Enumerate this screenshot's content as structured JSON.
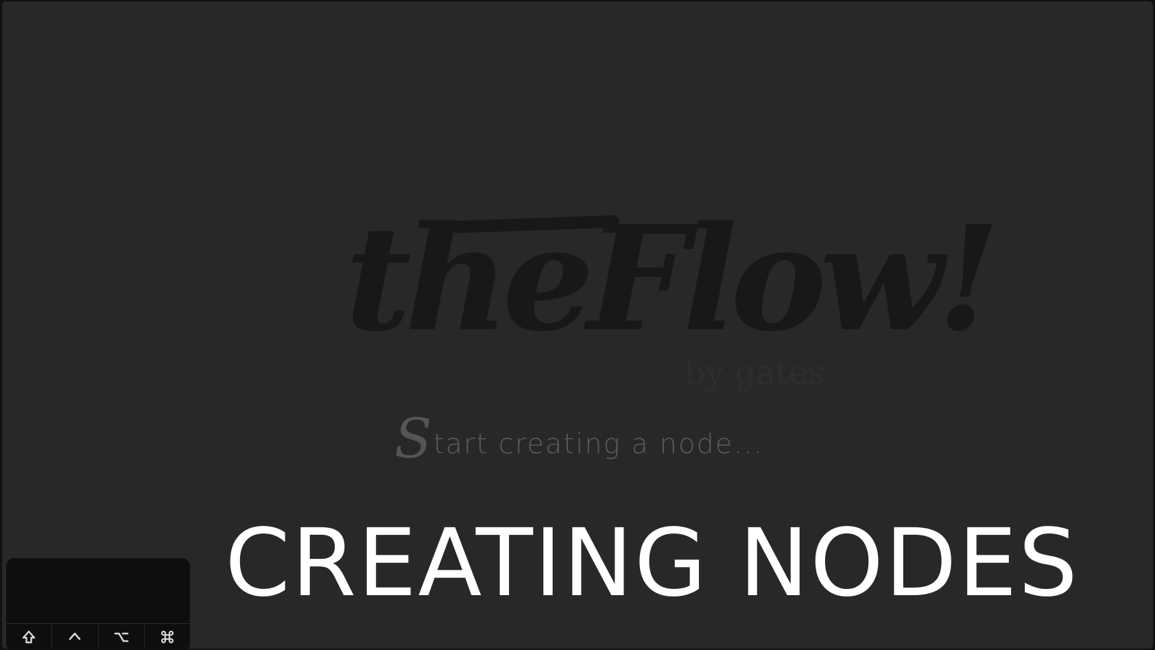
{
  "logo": {
    "title": "theFlow!",
    "byline": "by gates"
  },
  "canvas": {
    "tagline_initial": "S",
    "tagline_rest": "tart creating a node..."
  },
  "caption": {
    "text": "CREATING NODES"
  },
  "key_panel": {
    "keys": [
      {
        "icon": "shift-key-icon",
        "symbol": "⇧"
      },
      {
        "icon": "control-key-icon",
        "symbol": "^"
      },
      {
        "icon": "option-key-icon",
        "symbol": "⌥"
      },
      {
        "icon": "command-key-icon",
        "symbol": "⌘"
      }
    ]
  }
}
